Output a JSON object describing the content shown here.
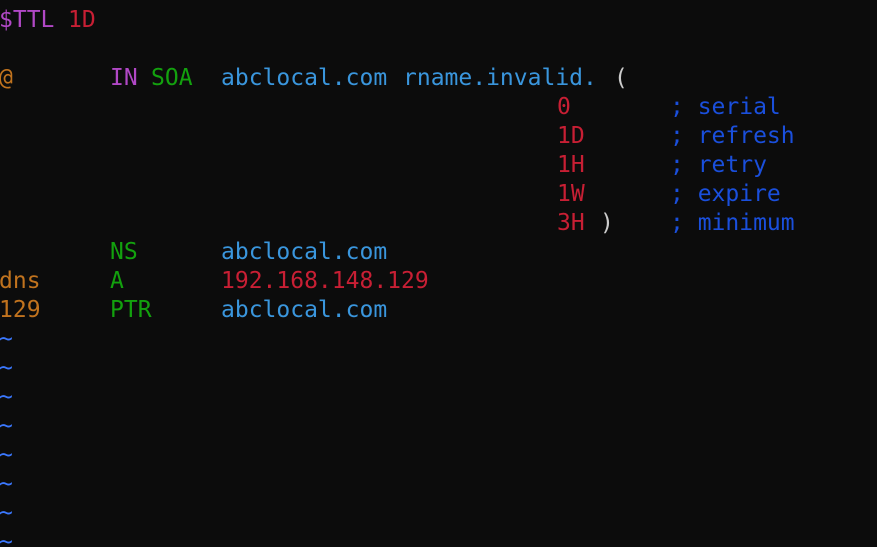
{
  "ttl_line": {
    "directive": "$TTL",
    "value": "1D"
  },
  "soa_line": {
    "name": "@",
    "class": "IN",
    "type": "SOA",
    "mname": "abclocal.com",
    "rname": "rname.invalid.",
    "open_paren": "("
  },
  "soa_fields": [
    {
      "value": "0",
      "comment": "; serial"
    },
    {
      "value": "1D",
      "comment": "; refresh"
    },
    {
      "value": "1H",
      "comment": "; retry"
    },
    {
      "value": "1W",
      "comment": "; expire"
    },
    {
      "value": "3H",
      "comment": "; minimum",
      "close_paren": ")"
    }
  ],
  "records": [
    {
      "name": "",
      "type": "NS",
      "data": "abclocal.com"
    },
    {
      "name": "dns",
      "type": "A",
      "data": "192.168.148.129"
    },
    {
      "name": "129",
      "type": "PTR",
      "data": "abclocal.com"
    }
  ],
  "empty_line_marker": "~",
  "colors": {
    "background": "#0c0c0c",
    "directive": "#b148c6",
    "number": "#c81f34",
    "record_type": "#13a10e",
    "domain": "#3a96dd",
    "owner_name": "#c1731e",
    "comment": "#1a4fdc",
    "tilde": "#3b78ff"
  }
}
